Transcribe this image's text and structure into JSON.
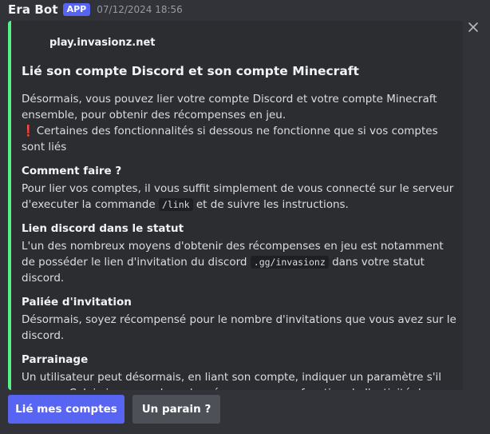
{
  "message": {
    "username": "Era Bot",
    "badge": "APP",
    "timestamp": "07/12/2024 18:56"
  },
  "embed": {
    "accent_color": "#57f287",
    "author": "play.invasionz.net",
    "title": "Lié son compte Discord et son compte Minecraft",
    "intro": "Désormais, vous pouvez lier votre compte Discord et votre compte Minecraft ensemble, pour obtenir des récompenses en jeu.",
    "warning_icon": "❗",
    "warning": "Certaines des fonctionnalités si dessous ne fonctionne que si vos comptes sont liés",
    "fields": [
      {
        "title": "Comment faire ?",
        "text_before": "Pour lier vos comptes, il vous suffit simplement de vous connecté sur le serveur d'executer la commande",
        "code": "/link",
        "text_after": "et de suivre les instructions."
      },
      {
        "title": "Lien discord dans le statut",
        "text_before": "L'un des nombreux moyens d'obtenir des récompenses en jeu est notamment de posséder le lien d'invitation du discord",
        "code": ".gg/invasionz",
        "text_after": "dans votre statut discord."
      },
      {
        "title": "Paliée d'invitation",
        "text": "Désormais, soyez récompensé pour le nombre d'invitations que vous avez sur le discord."
      },
      {
        "title": "Parrainage",
        "text": "Un utilisateur peut désormais, en liant son compte, indiquer un paramètre s'il en a un. Celui-ci recevra donc des récompenses en fonction de l'activité de son filleul"
      }
    ]
  },
  "buttons": {
    "primary_label": "Lié mes comptes",
    "secondary_label": "Un parain ?"
  },
  "icons": {
    "close": "close-icon"
  }
}
